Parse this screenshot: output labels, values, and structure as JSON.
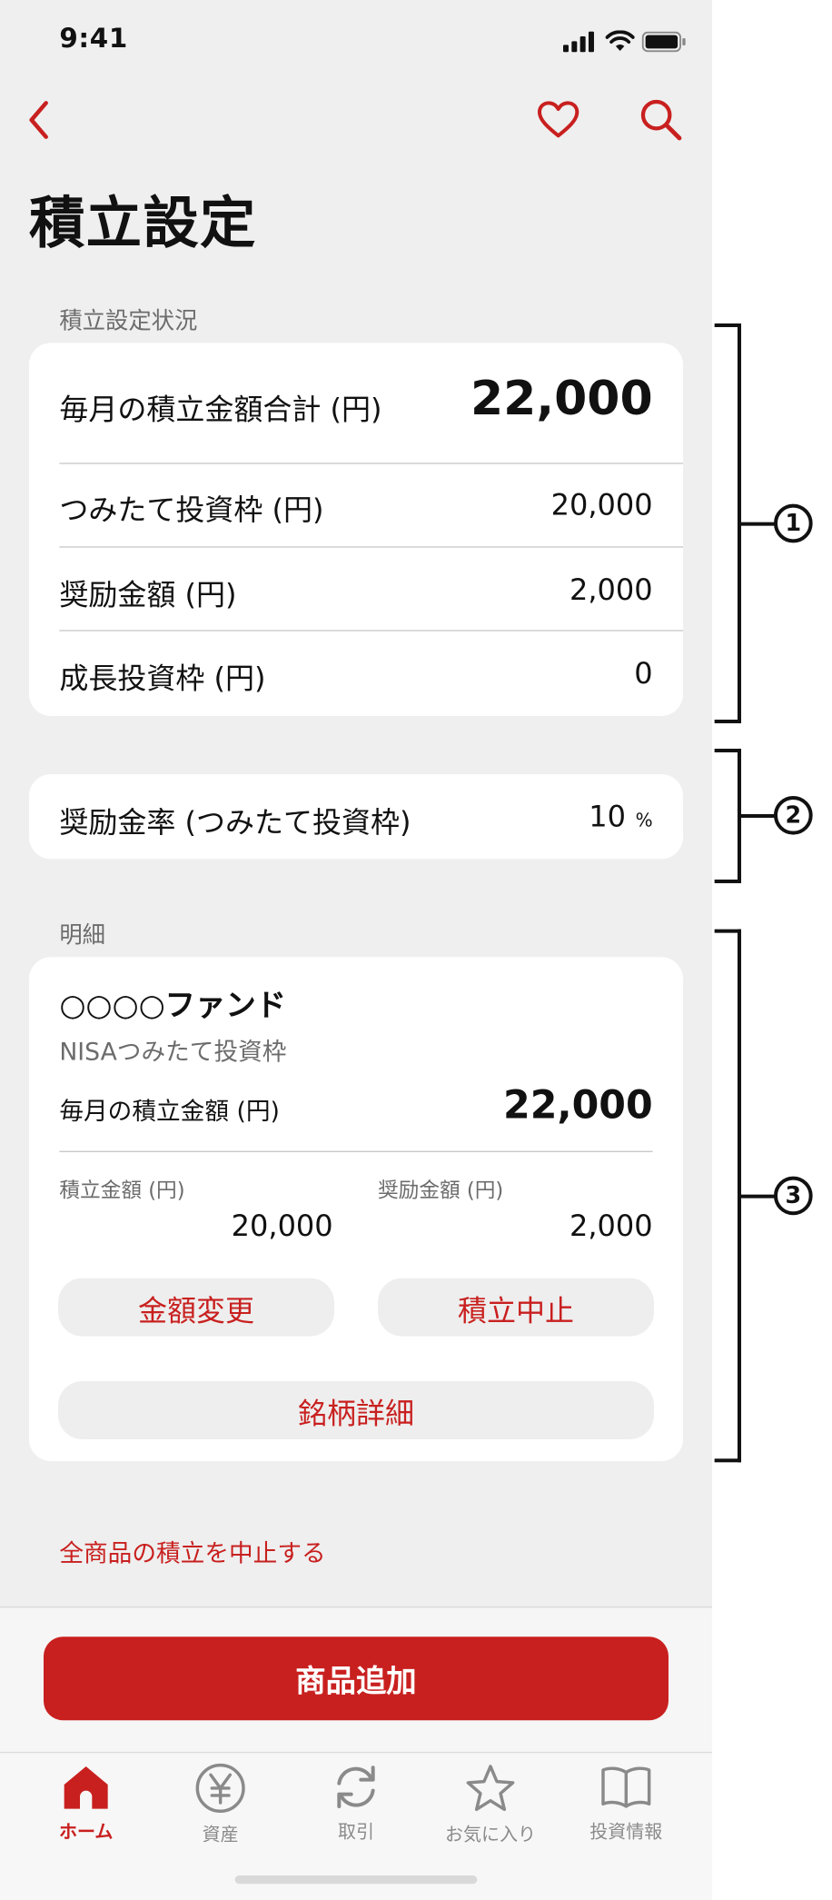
{
  "status_bar": {
    "time": "9:41"
  },
  "header": {
    "title": "積立設定"
  },
  "summary": {
    "section_label": "積立設定状況",
    "rows": [
      {
        "label": "毎月の積立金額合計 (円)",
        "value": "22,000"
      },
      {
        "label": "つみたて投資枠 (円)",
        "value": "20,000"
      },
      {
        "label": "奨励金額 (円)",
        "value": "2,000"
      },
      {
        "label": "成長投資枠 (円)",
        "value": "0"
      }
    ]
  },
  "rate": {
    "label": "奨励金率 (つみたて投資枠)",
    "value": "10",
    "unit": "%"
  },
  "detail": {
    "section_label": "明細",
    "fund_name": "○○○○ファンド",
    "fund_type": "NISAつみたて投資枠",
    "monthly_label": "毎月の積立金額 (円)",
    "monthly_value": "22,000",
    "amount_label": "積立金額 (円)",
    "amount_value": "20,000",
    "incentive_label": "奨励金額 (円)",
    "incentive_value": "2,000",
    "change_button": "金額変更",
    "stop_button": "積立中止",
    "details_button": "銘柄詳細"
  },
  "stop_all_link": "全商品の積立を中止する",
  "add_product_button": "商品追加",
  "tabs": [
    {
      "label": "ホーム",
      "icon": "home-icon",
      "active": true
    },
    {
      "label": "資産",
      "icon": "yen-icon",
      "active": false
    },
    {
      "label": "取引",
      "icon": "refresh-icon",
      "active": false
    },
    {
      "label": "お気に入り",
      "icon": "star-icon",
      "active": false
    },
    {
      "label": "投資情報",
      "icon": "book-icon",
      "active": false
    }
  ],
  "annotations": [
    "1",
    "2",
    "3"
  ],
  "colors": {
    "accent": "#c8201f",
    "background": "#efefef",
    "card": "#ffffff"
  }
}
